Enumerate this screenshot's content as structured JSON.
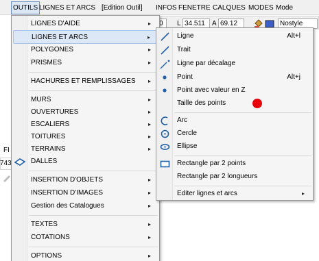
{
  "menubar": {
    "items": [
      "OUTILS",
      "LIGNES ET ARCS",
      "[Edition Outil]",
      "INFOS",
      "FENETRE",
      "CALQUES",
      "MODES",
      "Mode"
    ]
  },
  "toolbar": {
    "field_zero": "0",
    "l_label": "L",
    "l_value": "34.511",
    "a_label": "A",
    "a_value": "69.12",
    "style_value": "Nostyle",
    "left_fragment_top": "FI",
    "left_fragment_value": "743"
  },
  "menu": {
    "items": [
      {
        "label": "LIGNES D'AIDE",
        "arrow": "▸"
      },
      {
        "label": "LIGNES ET ARCS",
        "arrow": "▸"
      },
      {
        "label": "POLYGONES",
        "arrow": "▸"
      },
      {
        "label": "PRISMES",
        "arrow": "▸"
      },
      {
        "label": "HACHURES ET REMPLISSAGES",
        "arrow": "▸"
      },
      {
        "label": "MURS",
        "arrow": "▸"
      },
      {
        "label": "OUVERTURES",
        "arrow": "▸"
      },
      {
        "label": "ESCALIERS",
        "arrow": "▸"
      },
      {
        "label": "TOITURES",
        "arrow": "▸"
      },
      {
        "label": "TERRAINS",
        "arrow": "▸"
      },
      {
        "label": "DALLES",
        "arrow": ""
      },
      {
        "label": "INSERTION D'OBJETS",
        "arrow": "▸"
      },
      {
        "label": "INSERTION D'IMAGES",
        "arrow": "▸"
      },
      {
        "label": "Gestion des Catalogues",
        "arrow": "▸"
      },
      {
        "label": "TEXTES",
        "arrow": "▸"
      },
      {
        "label": "COTATIONS",
        "arrow": "▸"
      },
      {
        "label": "OPTIONS",
        "arrow": "▸"
      }
    ]
  },
  "submenu": {
    "items": [
      {
        "label": "Ligne",
        "shortcut": "Alt+l"
      },
      {
        "label": "Trait",
        "shortcut": ""
      },
      {
        "label": "Ligne par décalage",
        "shortcut": ""
      },
      {
        "label": "Point",
        "shortcut": "Alt+j"
      },
      {
        "label": "Point avec valeur en Z",
        "shortcut": ""
      },
      {
        "label": "Taille des points",
        "shortcut": ""
      },
      {
        "label": "Arc",
        "shortcut": ""
      },
      {
        "label": "Cercle",
        "shortcut": ""
      },
      {
        "label": "Ellipse",
        "shortcut": ""
      },
      {
        "label": "Rectangle par 2 points",
        "shortcut": ""
      },
      {
        "label": "Rectangle par 2 longueurs",
        "shortcut": ""
      },
      {
        "label": "Editer lignes et arcs",
        "shortcut": "",
        "arrow": "▸"
      }
    ]
  },
  "colors": {
    "highlight": "#dde8f7",
    "red_marker": "#e8000b",
    "icon_blue": "#1f5fa8"
  },
  "icons": {
    "line": "diagonal-line-icon",
    "trait": "diagonal-line-icon",
    "offset_line": "offset-line-icon",
    "point": "point-icon",
    "point_z": "point-z-icon",
    "arc": "arc-icon",
    "circle": "circle-icon",
    "ellipse": "ellipse-icon",
    "rectangle": "rectangle-icon",
    "slab": "slab-icon"
  }
}
